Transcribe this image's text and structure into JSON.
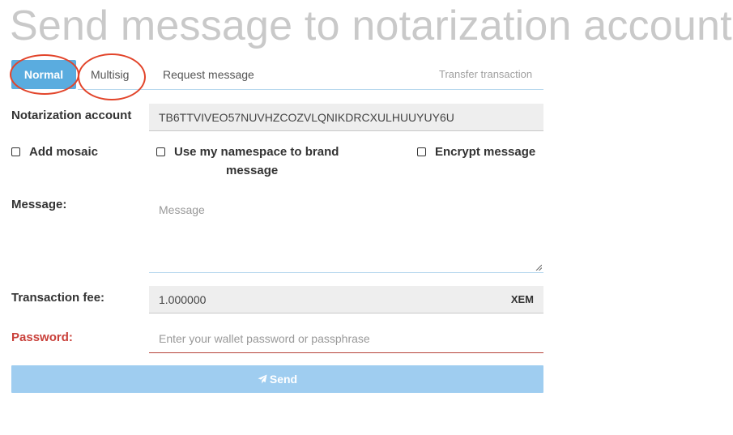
{
  "page": {
    "title": "Send message to notarization account"
  },
  "tabs": {
    "normal": "Normal",
    "multisig": "Multisig",
    "request": "Request message",
    "transfer": "Transfer transaction"
  },
  "account": {
    "label": "Notarization account",
    "value": "TB6TTVIVEO57NUVHZCOZVLQNIKDRCXULHUUYUY6U"
  },
  "options": {
    "add_mosaic": "Add mosaic",
    "namespace_line1": "Use my namespace to brand",
    "namespace_line2": "message",
    "encrypt": "Encrypt message"
  },
  "message": {
    "label": "Message:",
    "placeholder": "Message"
  },
  "fee": {
    "label": "Transaction fee:",
    "value": "1.000000",
    "unit": "XEM"
  },
  "password": {
    "label": "Password:",
    "placeholder": "Enter your wallet password or passphrase"
  },
  "send": {
    "label": "Send"
  },
  "colors": {
    "accent": "#5aacdf",
    "send_button": "#9fcdf0",
    "annotation_ring": "#e2442a",
    "password_label": "#c9403a"
  }
}
